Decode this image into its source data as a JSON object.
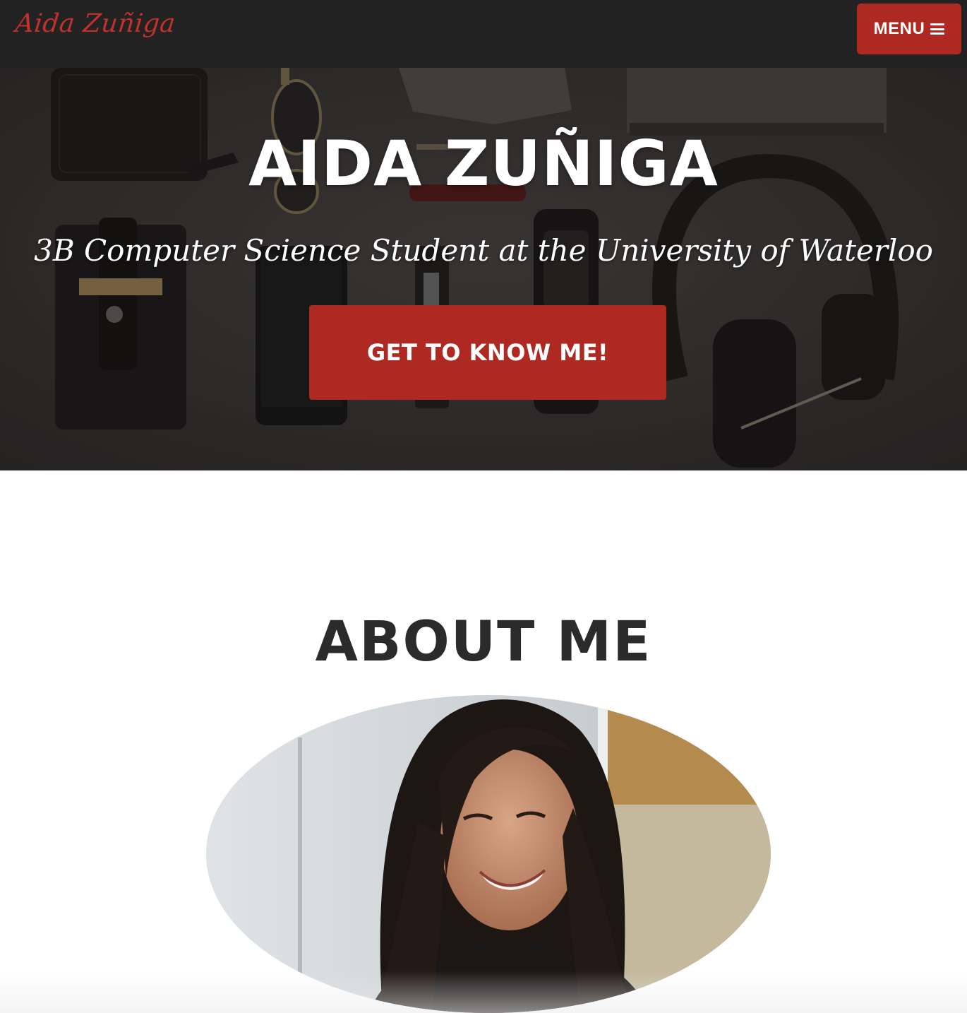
{
  "navbar": {
    "brand": "Aida Zuñiga",
    "menu_label": "MENU",
    "menu_icon": "bars-icon"
  },
  "hero": {
    "title": "AIDA ZUÑIGA",
    "subtitle": "3B Computer Science Student at the University of Waterloo",
    "cta_label": "GET TO KNOW ME!"
  },
  "about": {
    "title": "ABOUT ME"
  },
  "colors": {
    "navbar_bg": "#222222",
    "accent": "#ad2922",
    "brand_text": "#c0322b",
    "heading_text": "#2b2b2b"
  }
}
